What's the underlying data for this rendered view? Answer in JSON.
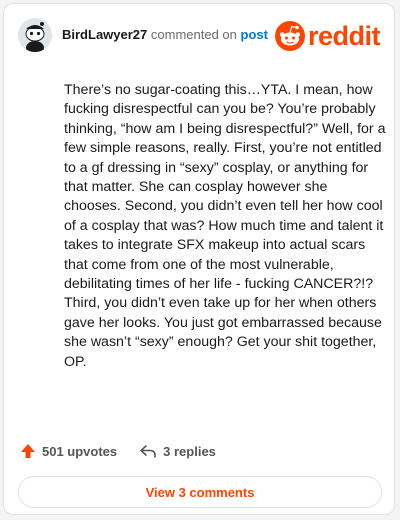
{
  "header": {
    "username": "BirdLawyer27",
    "action_text": "commented on",
    "post_link": "post",
    "logo_text": "reddit"
  },
  "comment": {
    "body": "There’s no sugar-coating this…YTA. I mean, how fucking disrespectful can you be? You’re probably thinking, “how am I being disrespectful?” Well, for a few simple reasons, really. First, you’re not entitled to a gf dressing in “sexy” cosplay, or anything for that matter. She can cosplay however she chooses. Second, you didn’t even tell her how cool of a cosplay that was? How much time and talent it takes to integrate SFX makeup into actual scars that come from one of the most vulnerable, debilitating times of her life - fucking CANCER?!? Third, you didn’t even take up for her when others gave her looks. You just got embarrassed because she wasn’t “sexy” enough? Get your shit together, OP."
  },
  "actions": {
    "upvotes": "501 upvotes",
    "replies": "3 replies"
  },
  "footer": {
    "view_comments": "View 3 comments"
  },
  "colors": {
    "brand": "#ff4500",
    "link": "#0079d3",
    "text": "#1a1a1b"
  },
  "icons": {
    "avatar": "snoo-avatar",
    "logo": "reddit-snoo-icon",
    "upvote": "upvote-arrow-icon",
    "reply": "reply-arrow-icon"
  }
}
